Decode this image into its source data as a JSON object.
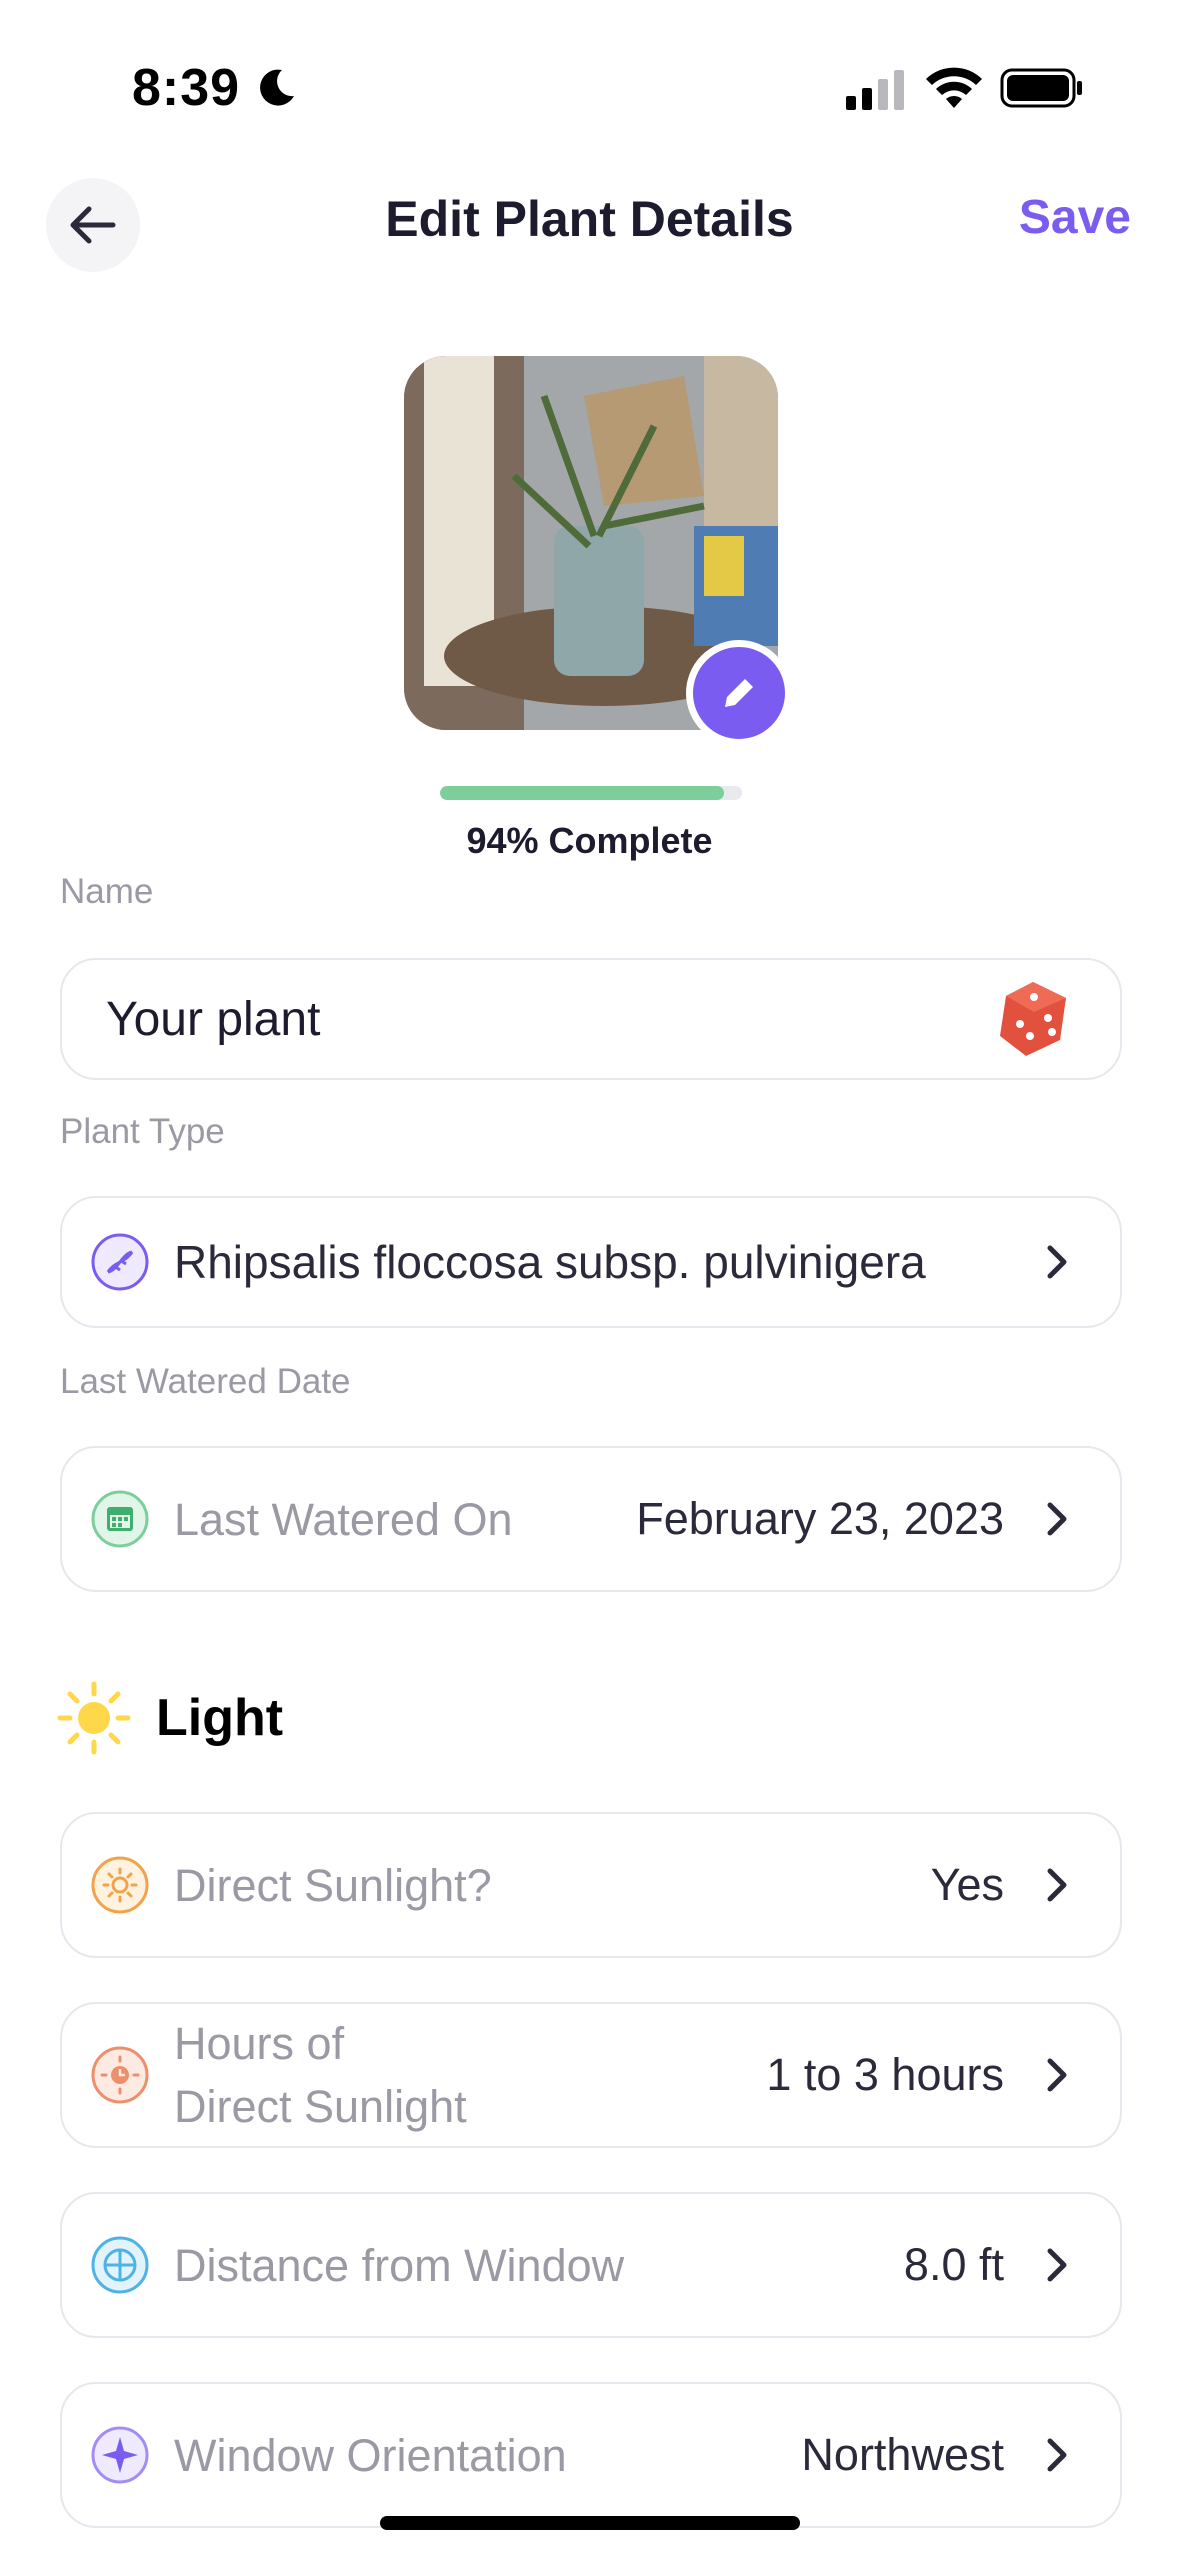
{
  "status_bar": {
    "time": "8:39",
    "icons": [
      "moon-icon",
      "signal-icon",
      "wifi-icon",
      "battery-icon"
    ]
  },
  "header": {
    "title": "Edit Plant Details",
    "save_label": "Save",
    "back_icon": "arrow-left-icon"
  },
  "photo": {
    "edit_icon": "pencil-icon",
    "accent_color": "#7a5cf0"
  },
  "progress": {
    "percent": 94,
    "label": "94% Complete",
    "fill_color": "#7ccf9b"
  },
  "name": {
    "label": "Name",
    "value": "Your plant",
    "randomize_icon": "dice-icon"
  },
  "plant_type": {
    "label": "Plant Type",
    "value": "Rhipsalis floccosa subsp. pulvinigera",
    "icon": "dna-icon"
  },
  "last_watered": {
    "label": "Last Watered Date",
    "field_label": "Last Watered On",
    "value": "February 23, 2023",
    "icon": "calendar-icon"
  },
  "light": {
    "title": "Light",
    "icon": "sun-icon",
    "rows": [
      {
        "label": "Direct Sunlight?",
        "value": "Yes",
        "icon": "sun-outline-icon"
      },
      {
        "label": "Hours of\nDirect Sunlight",
        "value": "1 to 3 hours",
        "icon": "sun-clock-icon"
      },
      {
        "label": "Distance from Window",
        "value": "8.0 ft",
        "icon": "window-icon"
      },
      {
        "label": "Window Orientation",
        "value": "Northwest",
        "icon": "compass-icon"
      }
    ]
  }
}
